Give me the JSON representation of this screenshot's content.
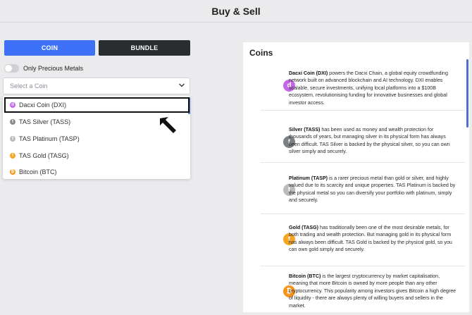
{
  "header": {
    "title": "Buy & Sell"
  },
  "tabs": {
    "coin": "COIN",
    "bundle": "BUNDLE"
  },
  "filter": {
    "toggle_label": "Only Precious Metals",
    "toggle_on": false
  },
  "select": {
    "placeholder": "Select a Coin"
  },
  "dropdown": {
    "items": [
      {
        "label": "Dacxi Coin (DXI)",
        "icon": "dacxi-coin-icon",
        "color": "#c466e8",
        "glyph": "d",
        "selected": true
      },
      {
        "label": "TAS Silver (TASS)",
        "icon": "tas-silver-icon",
        "color": "#888b8d",
        "glyph": "t"
      },
      {
        "label": "TAS Platinum (TASP)",
        "icon": "tas-platinum-icon",
        "color": "#b8babc",
        "glyph": "t"
      },
      {
        "label": "TAS Gold (TASG)",
        "icon": "tas-gold-icon",
        "color": "#f5a623",
        "glyph": "t"
      },
      {
        "label": "Bitcoin (BTC)",
        "icon": "bitcoin-icon",
        "color": "#f7931a",
        "glyph": "₿"
      }
    ]
  },
  "coins_panel": {
    "title": "Coins",
    "cards": [
      {
        "name": "Dacxi Coin (DXI)",
        "icon": "dacxi-coin-icon",
        "color": "#c466e8",
        "glyph": "d",
        "desc": " powers the Dacxi Chain, a global equity crowdfunding network built on advanced blockchain and AI technology. DXI enables scalable, secure investments, unifying local platforms into a $100B ecosystem, revolutionising funding for innovative businesses and global investor access."
      },
      {
        "name": "Silver (TASS)",
        "icon": "silver-coin-icon",
        "color": "#7d8083",
        "glyph": "t",
        "desc": " has been used as money and wealth protection for thousands of years, but managing silver in its physical form has always been difficult. TAS Silver is backed by the physical silver, so you can own silver simply and securely."
      },
      {
        "name": "Platinum (TASP)",
        "icon": "platinum-coin-icon",
        "color": "#b9bbbd",
        "glyph": "t",
        "desc": " is a rarer precious metal than gold or silver, and highly valued due to its scarcity and unique properties. TAS Platinum is backed by the physical metal so you can diversify your portfolio with platinum, simply and securely."
      },
      {
        "name": "Gold (TASG)",
        "icon": "gold-coin-icon",
        "color": "#f5a623",
        "glyph": "t",
        "desc": " has traditionally been one of the most desirable metals, for both trading and wealth protection. But managing gold in its physical form has always been difficult. TAS Gold is backed by the physical gold, so you can own gold simply and securely."
      },
      {
        "name": "Bitcoin (BTC)",
        "icon": "bitcoin-coin-icon",
        "color": "#f7931a",
        "glyph": "₿",
        "desc": " is the largest cryptocurrency by market capitalisation, meaning that more Bitcoin is owned by more people than any other cryptocurrency. This popularity among investors gives Bitcoin a high degree of liquidity - there are always plenty of willing buyers and sellers in the market."
      }
    ]
  }
}
